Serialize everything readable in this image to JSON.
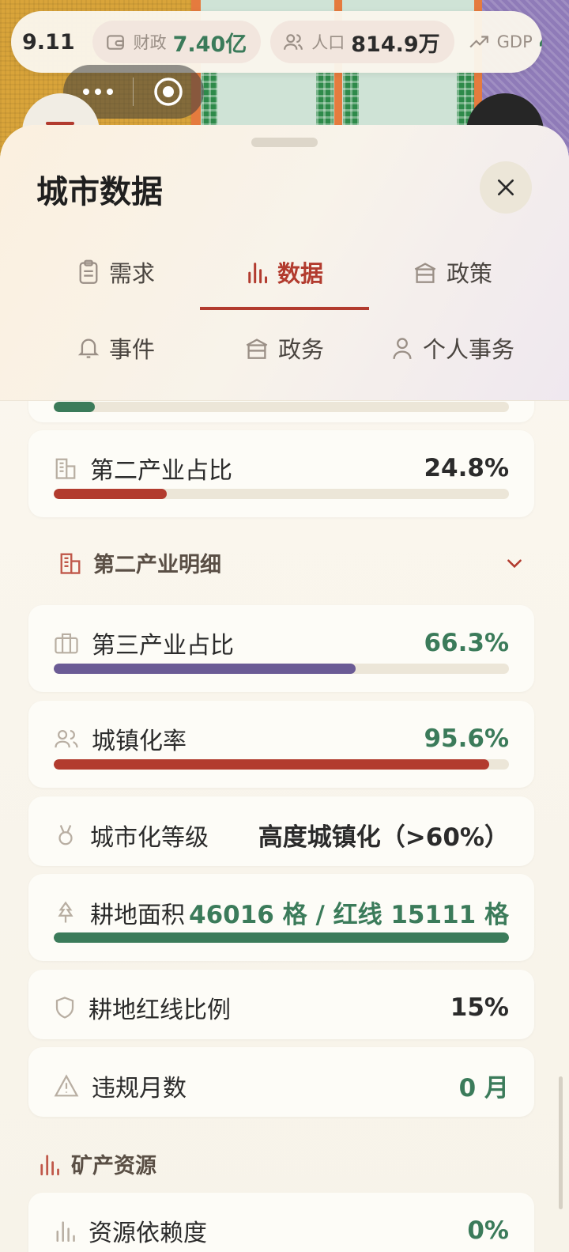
{
  "status_bar": {
    "date_partial": "9.11",
    "finance": {
      "label": "财政",
      "value": "7.40亿",
      "color": "#3b7b5a"
    },
    "population": {
      "label": "人口",
      "value": "814.9万",
      "color": "#2b2b2b"
    },
    "gdp": {
      "label": "GDP",
      "value_partial": "4",
      "color": "#3b7b5a"
    }
  },
  "panel": {
    "title": "城市数据",
    "tabs": [
      {
        "label": "需求",
        "icon": "clipboard-icon",
        "active": false
      },
      {
        "label": "数据",
        "icon": "bar-chart-icon",
        "active": true
      },
      {
        "label": "政策",
        "icon": "building-icon",
        "active": false
      },
      {
        "label": "事件",
        "icon": "bell-icon",
        "active": false
      },
      {
        "label": "政务",
        "icon": "building-icon",
        "active": false
      },
      {
        "label": "个人事务",
        "icon": "person-icon",
        "active": false
      }
    ]
  },
  "metrics": [
    {
      "id": "prev-bar",
      "fraction": 0.09,
      "bar_color": "#3b7b5a"
    },
    {
      "id": "secondary",
      "label": "第二产业占比",
      "value": "24.8%",
      "value_color": "#2b2b2b",
      "fraction": 0.248,
      "bar_color": "#b23b2e"
    },
    {
      "id": "secondary-detail",
      "label": "第二产业明细",
      "expanded": false
    },
    {
      "id": "tertiary",
      "label": "第三产业占比",
      "value": "66.3%",
      "value_color": "#3b7b5a",
      "fraction": 0.663,
      "bar_color": "#6b5b95"
    },
    {
      "id": "urbanization",
      "label": "城镇化率",
      "value": "95.6%",
      "value_color": "#3b7b5a",
      "fraction": 0.956,
      "bar_color": "#b23b2e"
    },
    {
      "id": "urban-level",
      "label": "城市化等级",
      "value": "高度城镇化（>60%）"
    },
    {
      "id": "farmland",
      "label": "耕地面积",
      "value": "46016 格 / 红线 15111 格",
      "fraction": 1.0,
      "bar_color": "#3b7b5a"
    },
    {
      "id": "redline-ratio",
      "label": "耕地红线比例",
      "value": "15%"
    },
    {
      "id": "violation",
      "label": "违规月数",
      "value": "0 月"
    },
    {
      "id": "minerals-section",
      "label": "矿产资源"
    },
    {
      "id": "resource-dependency",
      "label": "资源依赖度",
      "value": "0%"
    }
  ]
}
